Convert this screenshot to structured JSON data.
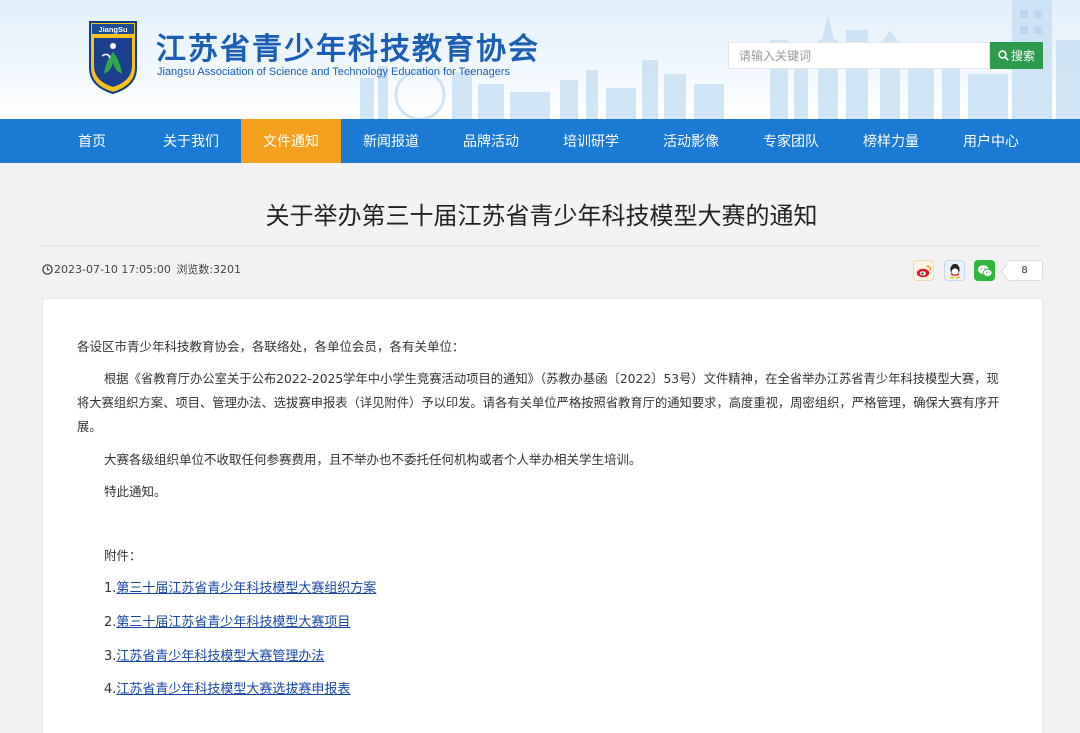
{
  "header": {
    "title": "江苏省青少年科技教育协会",
    "subtitle": "Jiangsu Association of Science and Technology Education for Teenagers",
    "logo_text": "JiangSu"
  },
  "search": {
    "placeholder": "请输入关键词",
    "button_label": "搜索",
    "icon": "search-icon"
  },
  "nav": {
    "items": [
      {
        "label": "首页",
        "active": false
      },
      {
        "label": "关于我们",
        "active": false
      },
      {
        "label": "文件通知",
        "active": true
      },
      {
        "label": "新闻报道",
        "active": false
      },
      {
        "label": "品牌活动",
        "active": false
      },
      {
        "label": "培训研学",
        "active": false
      },
      {
        "label": "活动影像",
        "active": false
      },
      {
        "label": "专家团队",
        "active": false
      },
      {
        "label": "榜样力量",
        "active": false
      },
      {
        "label": "用户中心",
        "active": false
      }
    ],
    "colors": {
      "background": "#1a7ad4",
      "active": "#f3a11c"
    }
  },
  "article": {
    "title": "关于举办第三十届江苏省青少年科技模型大赛的通知",
    "date": "2023-07-10 17:05:00",
    "views_label": "浏览数:3201",
    "share": {
      "icons": [
        "weibo-icon",
        "qq-icon",
        "wechat-icon"
      ],
      "count": "8"
    },
    "greeting": "各设区市青少年科技教育协会，各联络处，各单位会员，各有关单位：",
    "body": "根据《省教育厅办公室关于公布2022-2025学年中小学生竞赛活动项目的通知》（苏教办基函〔2022〕53号）文件精神，在全省举办江苏省青少年科技模型大赛，现将大赛组织方案、项目、管理办法、选拔赛申报表（详见附件）予以印发。请各有关单位严格按照省教育厅的通知要求，高度重视，周密组织，严格管理，确保大赛有序开展。",
    "notice": "大赛各级组织单位不收取任何参赛费用，且不举办也不委托任何机构或者个人举办相关学生培训。",
    "closing": "特此通知。",
    "attachments_label": "附件：",
    "attachments": [
      {
        "num": "1.",
        "label": "第三十届江苏省青少年科技模型大赛组织方案"
      },
      {
        "num": "2.",
        "label": "第三十届江苏省青少年科技模型大赛项目"
      },
      {
        "num": "3.",
        "label": "江苏省青少年科技模型大赛管理办法"
      },
      {
        "num": "4.",
        "label": "江苏省青少年科技模型大赛选拔赛申报表"
      }
    ]
  }
}
